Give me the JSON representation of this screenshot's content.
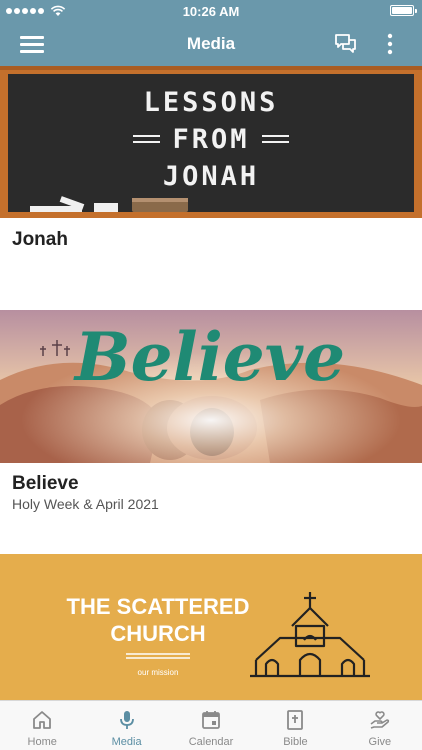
{
  "status_bar": {
    "time": "10:26 AM"
  },
  "header": {
    "title": "Media"
  },
  "media_items": [
    {
      "title": "Jonah",
      "subtitle": "",
      "banner_text": [
        "LESSONS",
        "FROM",
        "JONAH"
      ]
    },
    {
      "title": "Believe",
      "subtitle": "Holy Week & April 2021",
      "banner_text": "Believe"
    },
    {
      "banner_text": [
        "THE SCATTERED",
        "CHURCH"
      ],
      "banner_caption": "our mission"
    }
  ],
  "tabs": [
    {
      "label": "Home",
      "icon": "home-icon",
      "active": false
    },
    {
      "label": "Media",
      "icon": "microphone-icon",
      "active": true
    },
    {
      "label": "Calendar",
      "icon": "calendar-icon",
      "active": false
    },
    {
      "label": "Bible",
      "icon": "bible-icon",
      "active": false
    },
    {
      "label": "Give",
      "icon": "give-heart-hand-icon",
      "active": false
    }
  ],
  "colors": {
    "header_bg": "#6a98ab",
    "active_tab": "#5b8ea3",
    "inactive_tab": "#8a8a8a",
    "scattered_bg": "#e5ad4c",
    "chalkboard": "#2b2b2b",
    "chalkboard_frame": "#c4702c",
    "believe_green": "#1f8a74"
  }
}
